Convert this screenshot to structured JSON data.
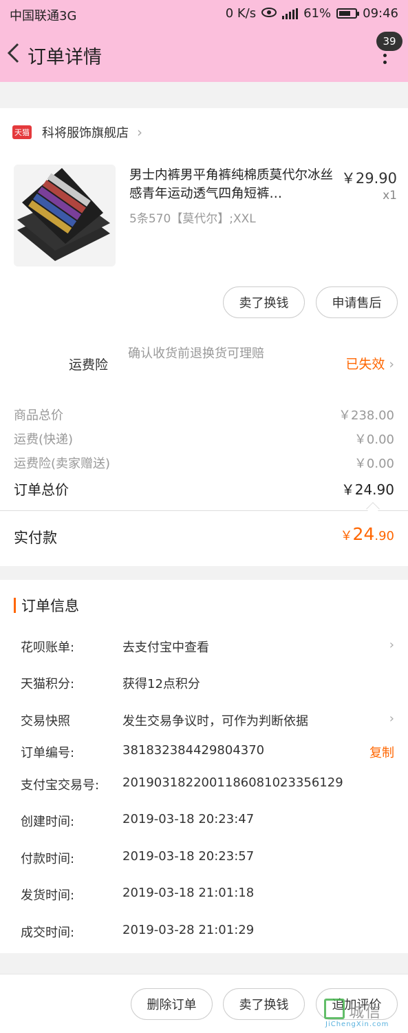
{
  "status_bar": {
    "carrier": "中国联通3G",
    "speed": "0 K/s",
    "battery_percent": "61%",
    "time": "09:46"
  },
  "header": {
    "title": "订单详情",
    "badge": "39"
  },
  "shop": {
    "icon_text": "天猫",
    "name": "科将服饰旗舰店"
  },
  "product": {
    "title": "男士内裤男平角裤纯棉质莫代尔冰丝感青年运动透气四角短裤…",
    "price": "￥29.90",
    "qty": "x1",
    "sku": "5条570【莫代尔】;XXL",
    "buttons": [
      "卖了换钱",
      "申请售后"
    ]
  },
  "insurance": {
    "label": "运费险",
    "desc": "确认收货前退换货可理赔",
    "status": "已失效"
  },
  "summary": {
    "rows": [
      {
        "label": "商品总价",
        "value": "￥238.00"
      },
      {
        "label": "运费(快递)",
        "value": "￥0.00"
      },
      {
        "label": "运费险(卖家赠送)",
        "value": "￥0.00"
      }
    ],
    "total_label": "订单总价",
    "total_value": "￥24.90",
    "paid_label": "实付款",
    "paid_currency": "￥",
    "paid_main": "24",
    "paid_decimal": ".90"
  },
  "order_info": {
    "title": "订单信息",
    "rows": [
      {
        "label": "花呗账单:",
        "value": "去支付宝中查看"
      },
      {
        "label": "天猫积分:",
        "value": "获得12点积分"
      },
      {
        "label": "交易快照",
        "value": "发生交易争议时，可作为判断依据"
      },
      {
        "label": "订单编号:",
        "value": "381832384429804370",
        "action": "复制"
      },
      {
        "label": "支付宝交易号:",
        "value": "2019031822001186081023356129"
      },
      {
        "label": "创建时间:",
        "value": "2019-03-18 20:23:47"
      },
      {
        "label": "付款时间:",
        "value": "2019-03-18 20:23:57"
      },
      {
        "label": "发货时间:",
        "value": "2019-03-18 21:01:18"
      },
      {
        "label": "成交时间:",
        "value": "2019-03-28 21:01:29"
      }
    ]
  },
  "bottom_bar": {
    "buttons": [
      "删除订单",
      "卖了换钱",
      "追加评价"
    ]
  },
  "watermark": {
    "text": "城信",
    "sub": "JiChengXin.com"
  }
}
